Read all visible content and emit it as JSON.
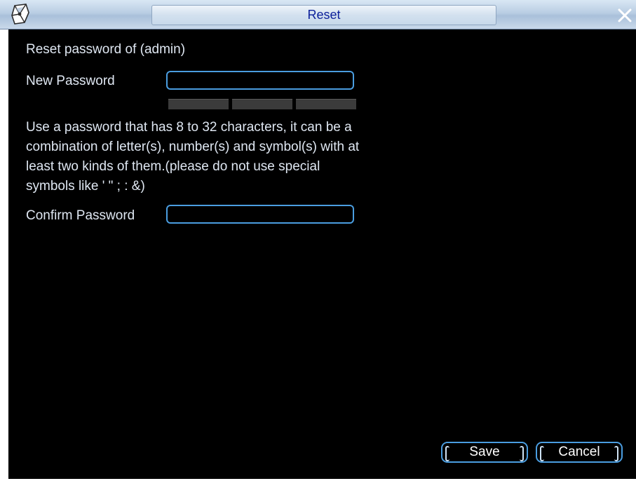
{
  "window": {
    "title": "Reset",
    "accent_color": "#4a9de0",
    "title_color": "#0b1f9a",
    "icons": [
      "app-logo-icon",
      "close-icon"
    ]
  },
  "form": {
    "heading": "Reset password of (admin)",
    "new_password_label": "New Password",
    "new_password_value": "",
    "strength_segments": 3,
    "hint": "Use a password that has 8 to 32 characters, it can be a combination of letter(s), number(s) and symbol(s) with at least two kinds of them.(please do not use special symbols like ' \" ; : &)",
    "confirm_password_label": "Confirm Password",
    "confirm_password_value": ""
  },
  "buttons": {
    "save": "Save",
    "cancel": "Cancel"
  }
}
